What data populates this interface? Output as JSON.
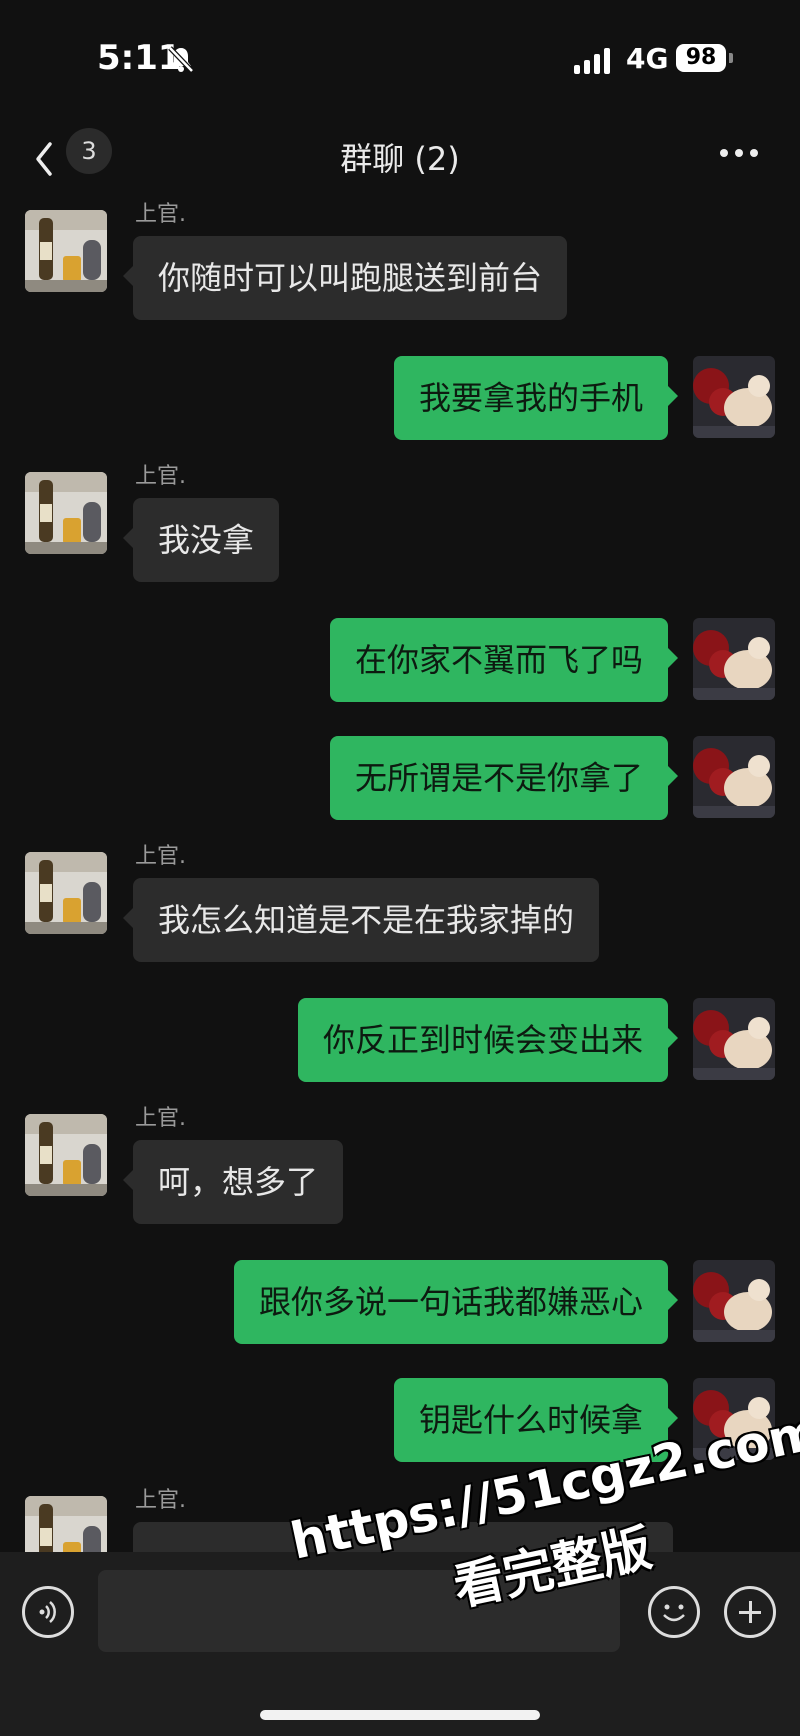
{
  "status_bar": {
    "time": "5:11",
    "network": "4G",
    "battery": "98"
  },
  "header": {
    "back_badge": "3",
    "title": "群聊 (2)"
  },
  "messages": [
    {
      "side": "in",
      "sender": "上官.",
      "text": "你随时可以叫跑腿送到前台"
    },
    {
      "side": "out",
      "text": "我要拿我的手机"
    },
    {
      "side": "in",
      "sender": "上官.",
      "text": "我没拿"
    },
    {
      "side": "out",
      "text": "在你家不翼而飞了吗"
    },
    {
      "side": "out",
      "text": "无所谓是不是你拿了"
    },
    {
      "side": "in",
      "sender": "上官.",
      "text": "我怎么知道是不是在我家掉的"
    },
    {
      "side": "out",
      "text": "你反正到时候会变出来"
    },
    {
      "side": "in",
      "sender": "上官.",
      "text": "呵，想多了"
    },
    {
      "side": "out",
      "text": "跟你多说一句话我都嫌恶心"
    },
    {
      "side": "out",
      "text": "钥匙什么时候拿"
    },
    {
      "side": "in",
      "sender": "上官.",
      "text": ""
    }
  ],
  "input_bar": {
    "placeholder": ""
  },
  "watermark": {
    "url": "https://51cgz2.com",
    "subtitle": "看完整版"
  },
  "icons": {
    "back": "chevron-left-icon",
    "more": "more-dots-icon",
    "voice": "voice-icon",
    "emoji": "emoji-icon",
    "plus": "plus-icon",
    "mute": "bell-slash-icon"
  },
  "colors": {
    "outgoing_bubble": "#2fb660",
    "incoming_bubble": "#2c2c2c",
    "background": "#111111"
  }
}
